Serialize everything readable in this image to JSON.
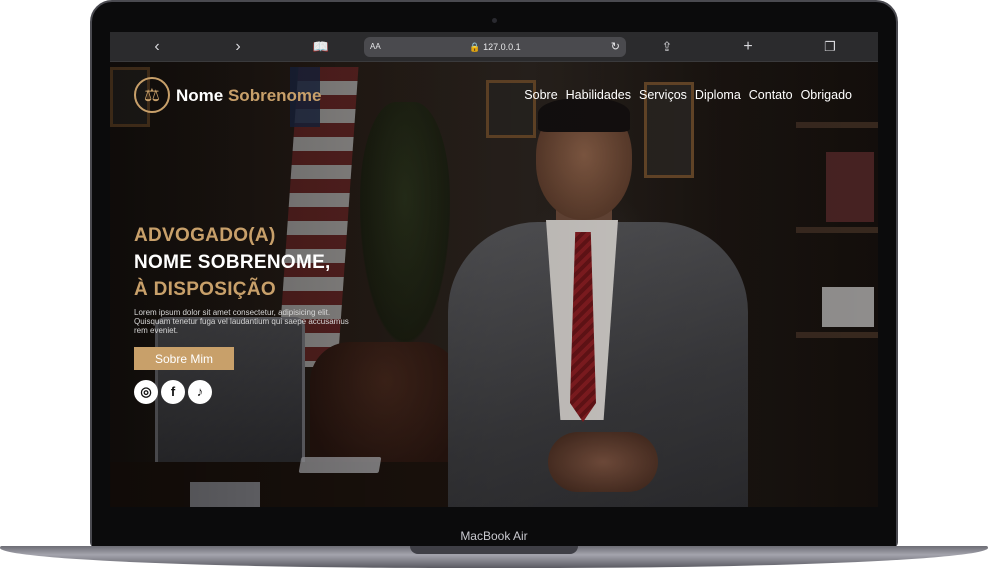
{
  "device": {
    "model_label": "MacBook Air"
  },
  "safari": {
    "back_icon": "chevron-left-icon",
    "forward_icon": "chevron-right-icon",
    "reader_icon": "book-icon",
    "text_size_label": "AA",
    "url": "🔒 127.0.0.1",
    "reload_icon": "reload-icon",
    "share_icon": "share-icon",
    "new_tab_icon": "plus-icon",
    "tabs_icon": "tabs-icon"
  },
  "site": {
    "logo_icon": "scales-of-justice-icon",
    "brand_first": "Nome",
    "brand_last": "Sobrenome",
    "nav": [
      "Sobre",
      "Habilidades",
      "Serviços",
      "Diploma",
      "Contato",
      "Obrigado"
    ],
    "hero": {
      "line1": "ADVOGADO(A)",
      "line2": "NOME SOBRENOME,",
      "line3_prefix": "À",
      "line3_word": "DISPOSIÇÃO",
      "body": "Lorem ipsum dolor sit amet consectetur, adipisicing elit. Quisquam tenetur fuga vel laudantium qui saepe accusamus rem eveniet.",
      "cta": "Sobre Mim"
    },
    "socials": [
      {
        "name": "instagram",
        "glyph": "◎"
      },
      {
        "name": "facebook",
        "glyph": "f"
      },
      {
        "name": "tiktok",
        "glyph": "♪"
      }
    ],
    "colors": {
      "accent": "#c8a06a",
      "text": "#ffffff"
    }
  }
}
